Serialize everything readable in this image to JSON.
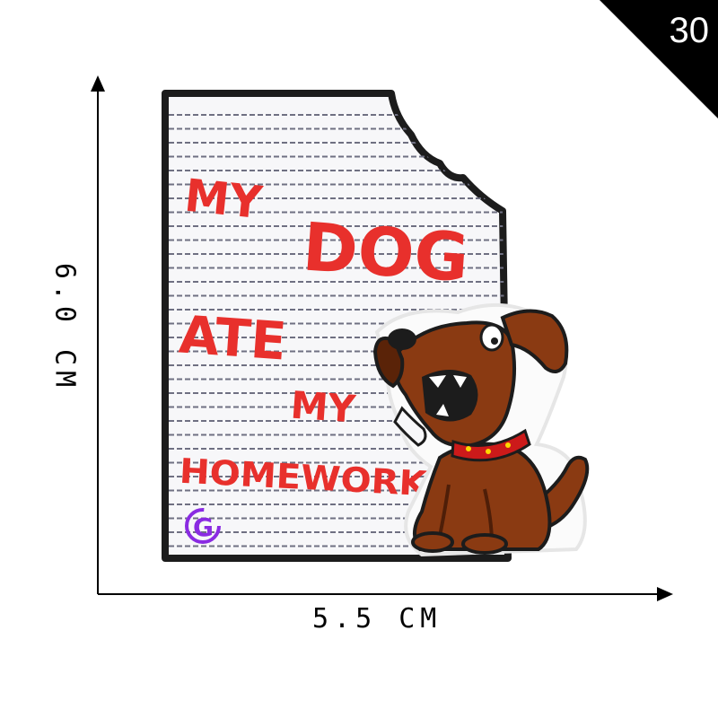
{
  "badge": {
    "number": "30",
    "color": "#000000"
  },
  "dimensions": {
    "width": "5.5 CM",
    "height": "6.0 CM"
  },
  "patch": {
    "text_lines": [
      "MY",
      "DOG",
      "ATE",
      "MY",
      "HOMEWORK"
    ],
    "logo": "G",
    "colors": {
      "paper": "#f7f7f9",
      "border": "#1c1c1c",
      "lines": "#6f7082",
      "text": "#e8302c",
      "dog": "#8a3a12",
      "dog_dark": "#4e1e08",
      "collar": "#cc1a1a",
      "logo": "#8a2be2"
    }
  }
}
